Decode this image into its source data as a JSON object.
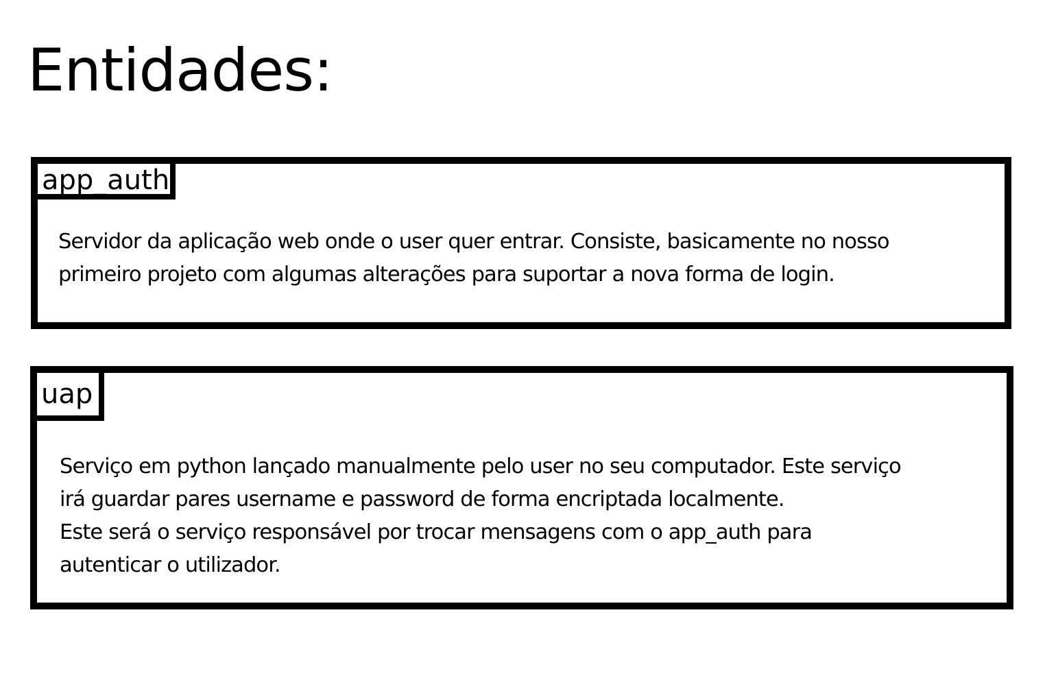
{
  "title": "Entidades:",
  "entities": [
    {
      "name": "app_auth",
      "description": "Servidor da aplicação web onde o user quer entrar. Consiste, basicamente no nosso\nprimeiro projeto com algumas alterações para suportar a nova forma de login."
    },
    {
      "name": "uap",
      "description": "Serviço em python lançado manualmente pelo user no seu computador. Este serviço\nirá guardar pares username e password de forma encriptada localmente.\nEste será o serviço responsável por trocar mensagens com o app_auth para\nautenticar o utilizador."
    }
  ]
}
